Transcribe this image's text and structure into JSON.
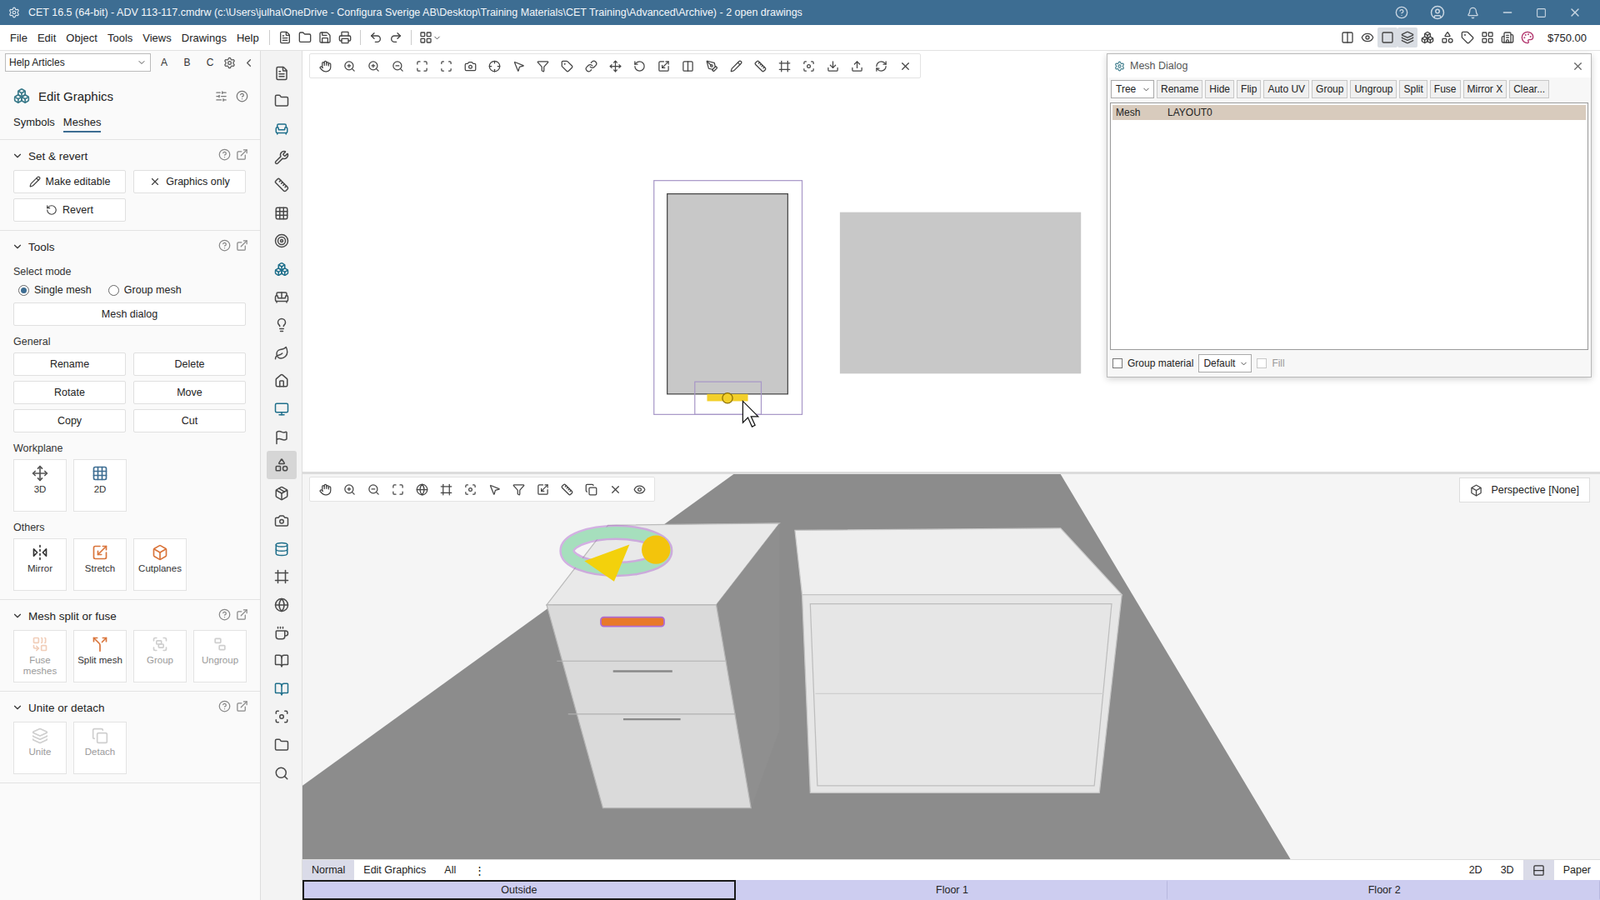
{
  "window": {
    "title": "CET 16.5 (64-bit) - ADV 113-117.cmdrw (c:\\Users\\julha\\OneDrive - Configura Sverige AB\\Desktop\\Training Materials\\CET Training\\Advanced\\Archive) - 2  open drawings"
  },
  "menu": [
    "File",
    "Edit",
    "Object",
    "Tools",
    "Views",
    "Drawings",
    "Help"
  ],
  "price": "$750.00",
  "help_bar": {
    "value": "Help Articles",
    "letters": [
      "A",
      "B",
      "C"
    ]
  },
  "panel": {
    "title": "Edit Graphics",
    "tabs": [
      {
        "label": "Symbols",
        "selected": false
      },
      {
        "label": "Meshes",
        "selected": true
      }
    ],
    "sections": [
      {
        "title": "Set & revert",
        "expanded": true,
        "items": [
          {
            "kind": "icon-buttons",
            "buttons": [
              {
                "label": "Make editable",
                "disabled": false
              },
              {
                "label": "Graphics only",
                "disabled": false
              }
            ]
          },
          {
            "kind": "icon-buttons",
            "buttons": [
              {
                "label": "Revert",
                "disabled": false
              }
            ]
          }
        ]
      },
      {
        "title": "Tools",
        "expanded": true,
        "items": [
          {
            "kind": "label",
            "text": "Select mode"
          },
          {
            "kind": "radios",
            "options": [
              {
                "label": "Single mesh",
                "selected": true
              },
              {
                "label": "Group mesh",
                "selected": false
              }
            ]
          },
          {
            "kind": "wide-button",
            "label": "Mesh dialog"
          },
          {
            "kind": "label",
            "text": "General"
          },
          {
            "kind": "buttons",
            "buttons": [
              {
                "label": "Rename",
                "disabled": false
              },
              {
                "label": "Delete",
                "disabled": false
              }
            ]
          },
          {
            "kind": "buttons",
            "buttons": [
              {
                "label": "Rotate",
                "disabled": false
              },
              {
                "label": "Move",
                "disabled": false
              }
            ]
          },
          {
            "kind": "buttons",
            "buttons": [
              {
                "label": "Copy",
                "disabled": false
              },
              {
                "label": "Cut",
                "disabled": false
              }
            ]
          },
          {
            "kind": "label",
            "text": "Workplane"
          },
          {
            "kind": "tiles",
            "tiles": [
              {
                "label": "3D",
                "disabled": false
              },
              {
                "label": "2D",
                "disabled": false
              }
            ]
          },
          {
            "kind": "label",
            "text": "Others"
          },
          {
            "kind": "tiles",
            "tiles": [
              {
                "label": "Mirror",
                "disabled": false
              },
              {
                "label": "Stretch",
                "disabled": false
              },
              {
                "label": "Cutplanes",
                "disabled": false
              }
            ]
          }
        ]
      },
      {
        "title": "Mesh split or fuse",
        "expanded": true,
        "items": [
          {
            "kind": "tiles",
            "tiles": [
              {
                "label": "Fuse meshes",
                "disabled": true
              },
              {
                "label": "Split mesh",
                "disabled": false
              },
              {
                "label": "Group",
                "disabled": true
              },
              {
                "label": "Ungroup",
                "disabled": true
              }
            ]
          }
        ]
      },
      {
        "title": "Unite or detach",
        "expanded": true,
        "items": [
          {
            "kind": "tiles",
            "tiles": [
              {
                "label": "Unite",
                "disabled": true
              },
              {
                "label": "Detach",
                "disabled": true
              }
            ]
          }
        ]
      }
    ]
  },
  "mesh_dialog": {
    "title": "Mesh Dialog",
    "view": "Tree",
    "buttons": [
      "Rename",
      "Hide",
      "Flip",
      "Auto UV",
      "Group",
      "Ungroup",
      "Split",
      "Fuse",
      "Mirror X",
      "Clear..."
    ],
    "rows": [
      {
        "cells": [
          "Mesh",
          "LAYOUT0"
        ],
        "selected": true
      }
    ],
    "group_material": {
      "label": "Group material",
      "checked": false
    },
    "material": "Default",
    "fill": {
      "label": "Fill",
      "checked": false,
      "disabled": true
    }
  },
  "viewport_3d": {
    "projection": "Perspective [None]"
  },
  "view_tabs": [
    {
      "label": "Normal",
      "selected": true
    },
    {
      "label": "Edit Graphics",
      "selected": false
    },
    {
      "label": "All",
      "selected": false
    }
  ],
  "view_tabs_more": "⋮",
  "view_modes": [
    {
      "kind": "text",
      "label": "2D",
      "selected": false
    },
    {
      "kind": "text",
      "label": "3D",
      "selected": false
    },
    {
      "kind": "icon",
      "selected": true
    },
    {
      "kind": "text",
      "label": "Paper",
      "selected": false
    }
  ],
  "floors": [
    {
      "label": "Outside",
      "selected": true
    },
    {
      "label": "Floor 1",
      "selected": false
    },
    {
      "label": "Floor 2",
      "selected": false
    }
  ]
}
